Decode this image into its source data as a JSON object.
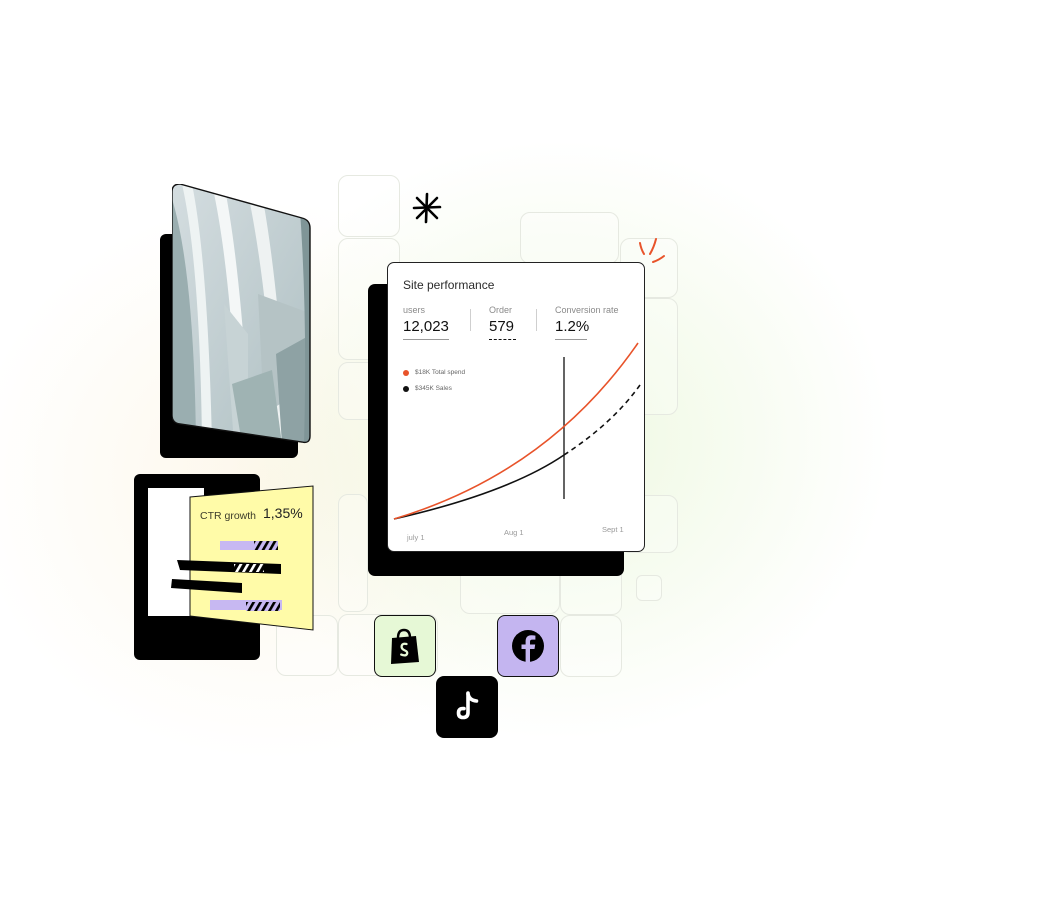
{
  "colors": {
    "accent_orange": "#E8532A",
    "ctr_yellow": "#FFFBA8",
    "bar_purple": "#C7B8F2",
    "shopify_bg": "#E6F8D6",
    "facebook_bg": "#C4B5F0",
    "tiktok_bg": "#000000"
  },
  "decorations": {
    "sparkle_icon": "asterisk-sparkle-icon",
    "burst_icon": "orange-burst-icon"
  },
  "photo_card": {
    "image": "architecture-photo"
  },
  "site_performance": {
    "title": "Site performance",
    "metrics": [
      {
        "label": "users",
        "value": "12,023"
      },
      {
        "label": "Order",
        "value": "579"
      },
      {
        "label": "Conversion rate",
        "value": "1.2%"
      }
    ],
    "legend": [
      {
        "label": "$18K Total spend",
        "color": "#E8532A"
      },
      {
        "label": "$345K Sales",
        "color": "#111111"
      }
    ],
    "x_labels": [
      "july 1",
      "Aug 1",
      "Sept 1"
    ]
  },
  "ctr_card": {
    "label": "CTR growth",
    "value": "1,35%"
  },
  "apps": [
    {
      "name": "Shopify",
      "icon": "shopify-icon"
    },
    {
      "name": "Facebook",
      "icon": "facebook-icon"
    },
    {
      "name": "TikTok",
      "icon": "tiktok-icon"
    }
  ]
}
